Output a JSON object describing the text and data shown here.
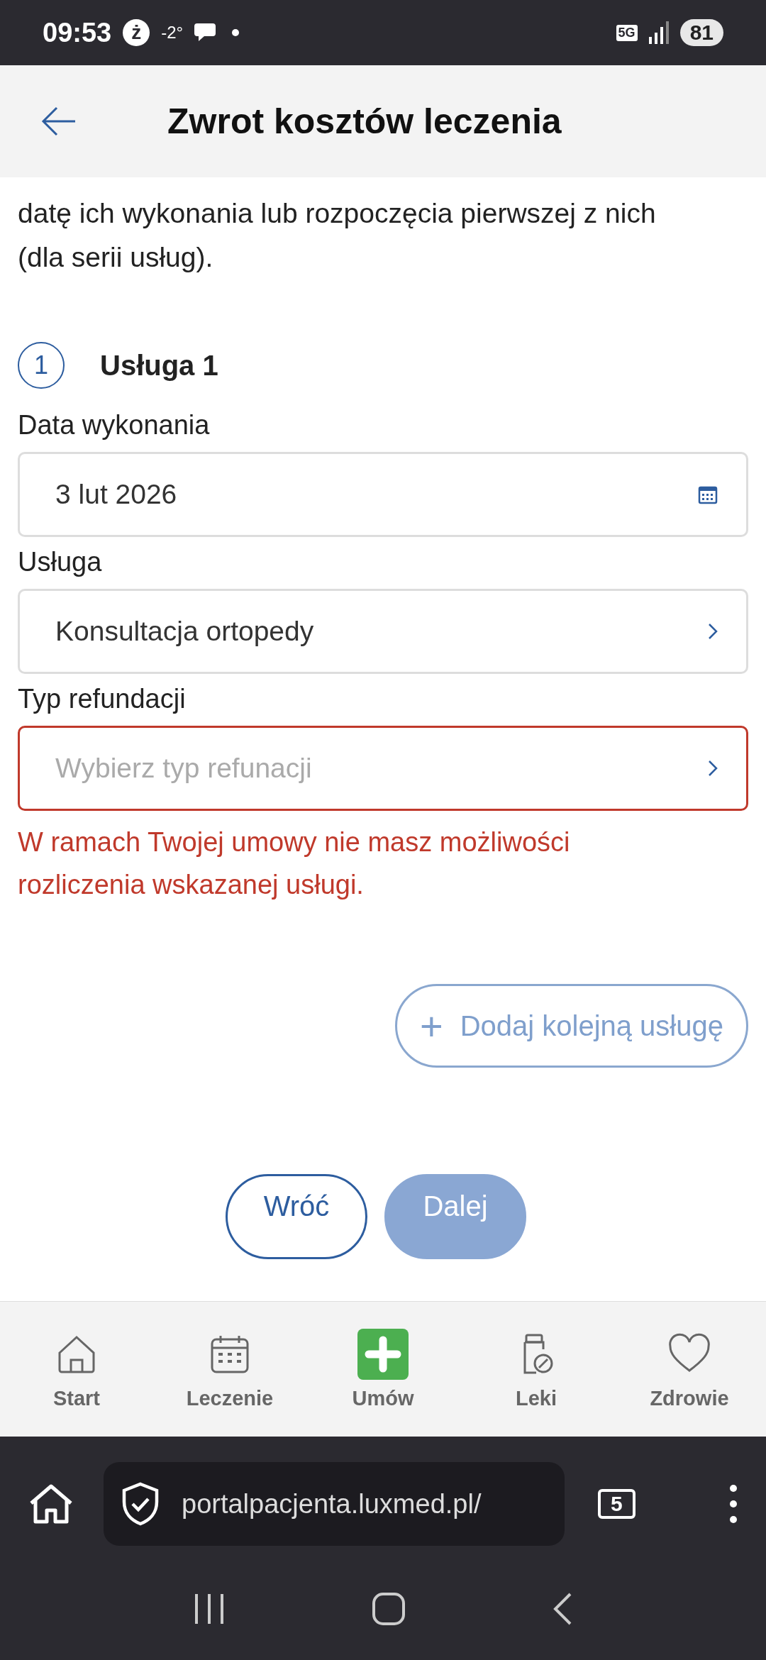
{
  "status_bar": {
    "time": "09:53",
    "app_badge": "ż",
    "temperature": "-2°",
    "network": "5G",
    "battery": "81"
  },
  "header": {
    "title": "Zwrot kosztów leczenia"
  },
  "intro": [
    "datę ich wykonania lub rozpoczęcia pierwszej z nich",
    "(dla serii usług)."
  ],
  "service": {
    "number": "1",
    "title": "Usługa 1",
    "fields": [
      {
        "label": "Data wykonania",
        "value": "3 lut 2026",
        "kind": "date",
        "error": false
      },
      {
        "label": "Usługa",
        "value": "Konsultacja ortopedy",
        "kind": "select",
        "error": false
      },
      {
        "label": "Typ refundacji",
        "placeholder": "Wybierz typ refunacji",
        "kind": "select",
        "error": true,
        "error_text": "W ramach Twojej umowy nie masz możliwości rozliczenia wskazanej usługi."
      }
    ]
  },
  "add_button": {
    "label": "Dodaj kolejną usługę",
    "icon": "+"
  },
  "actions": [
    {
      "label": "Wróć",
      "disabled": false
    },
    {
      "label": "Dalej",
      "disabled": true
    }
  ],
  "bottom_nav": [
    {
      "label": "Start",
      "kind": "home"
    },
    {
      "label": "Leczenie",
      "kind": "calendar"
    },
    {
      "label": "Umów",
      "kind": "plus"
    },
    {
      "label": "Leki",
      "kind": "medicine"
    },
    {
      "label": "Zdrowie",
      "kind": "heart"
    }
  ],
  "browser": {
    "url": "portalpacjenta.luxmed.pl/",
    "tabs": "5"
  }
}
